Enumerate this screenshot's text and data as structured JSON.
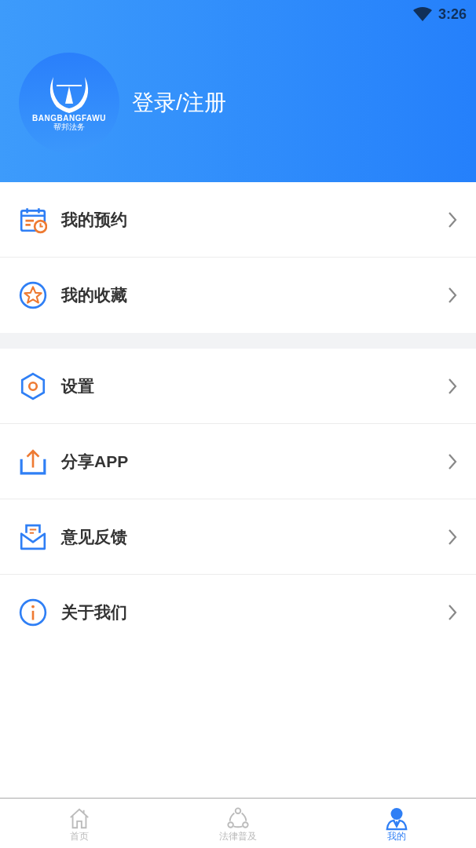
{
  "status_bar": {
    "time": "3:26"
  },
  "header": {
    "logo": {
      "brand": "BANGBANGFAWU",
      "subtitle": "帮邦法务"
    },
    "login_label": "登录/注册"
  },
  "menu_groups": [
    {
      "items": [
        {
          "kind": "calendar",
          "label": "我的预约"
        },
        {
          "kind": "star",
          "label": "我的收藏"
        }
      ]
    },
    {
      "items": [
        {
          "kind": "settings",
          "label": "设置"
        },
        {
          "kind": "share",
          "label": "分享APP"
        },
        {
          "kind": "feedback",
          "label": "意见反馈"
        },
        {
          "kind": "info",
          "label": "关于我们"
        }
      ]
    }
  ],
  "tab_bar": [
    {
      "kind": "home",
      "label": "首页",
      "selected": false
    },
    {
      "kind": "law",
      "label": "法律普及",
      "selected": false
    },
    {
      "kind": "me",
      "label": "我的",
      "selected": true
    }
  ]
}
